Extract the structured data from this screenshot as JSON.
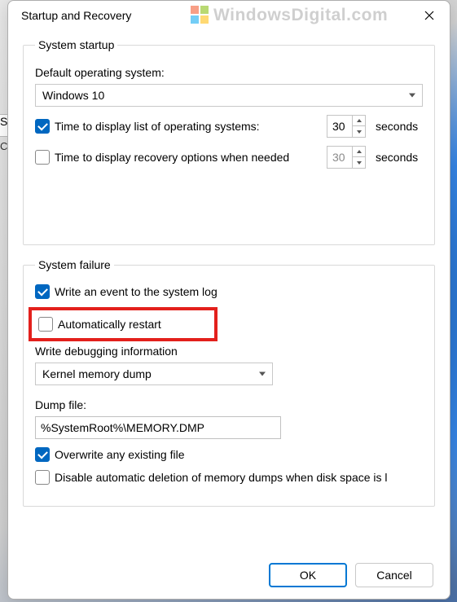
{
  "dialog": {
    "title": "Startup and Recovery"
  },
  "watermark": {
    "text": "WindowsDigital.com"
  },
  "startup": {
    "legend": "System startup",
    "defaultOsLabel": "Default operating system:",
    "defaultOs": "Windows 10",
    "displayListLabel": "Time to display list of operating systems:",
    "displayListSeconds": "30",
    "displayRecoveryLabel": "Time to display recovery options when needed",
    "displayRecoverySeconds": "30",
    "secondsUnit": "seconds"
  },
  "failure": {
    "legend": "System failure",
    "writeEventLabel": "Write an event to the system log",
    "autoRestartLabel": "Automatically restart",
    "writeDebugLabel": "Write debugging information",
    "dumpType": "Kernel memory dump",
    "dumpFileLabel": "Dump file:",
    "dumpFilePath": "%SystemRoot%\\MEMORY.DMP",
    "overwriteLabel": "Overwrite any existing file",
    "disableDeletionLabel": "Disable automatic deletion of memory dumps when disk space is l"
  },
  "buttons": {
    "ok": "OK",
    "cancel": "Cancel"
  },
  "side": {
    "text1": "Sy",
    "text2": "C"
  }
}
